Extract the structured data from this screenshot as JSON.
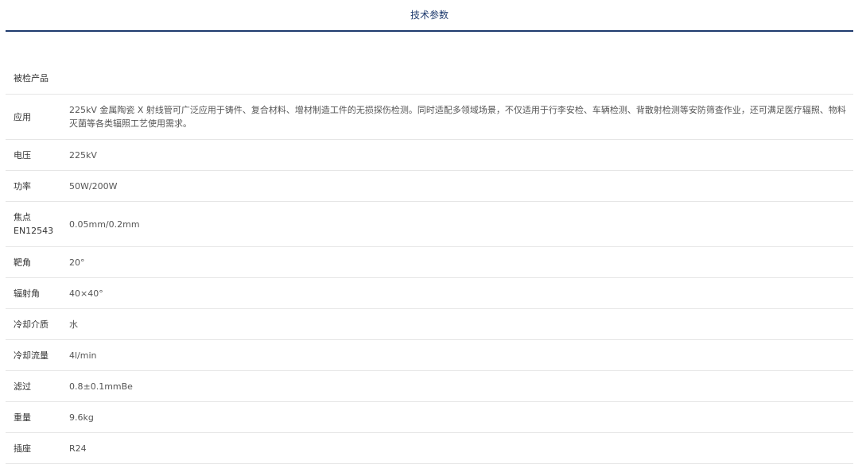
{
  "tabs": {
    "active_label": "技术参数"
  },
  "specs": {
    "product": {
      "label": "被检产品",
      "value": ""
    },
    "application": {
      "label": "应用",
      "value": "225kV 金属陶瓷 X 射线管可广泛应用于铸件、复合材料、增材制造工件的无损探伤检测。同时适配多领域场景，不仅适用于行李安检、车辆检测、背散射检测等安防筛查作业，还可满足医疗辐照、物料灭菌等各类辐照工艺使用需求。"
    },
    "voltage": {
      "label": "电压",
      "value": "225kV"
    },
    "power": {
      "label": "功率",
      "value": "50W/200W"
    },
    "focus": {
      "label_line1": "焦点",
      "label_line2": "EN12543",
      "value": "0.05mm/0.2mm"
    },
    "target_angle": {
      "label": "靶角",
      "value": "20°"
    },
    "radiation_angle": {
      "label": "辐射角",
      "value": "40×40°"
    },
    "cooling_medium": {
      "label": "冷却介质",
      "value": "水"
    },
    "cooling_flow": {
      "label": "冷却流量",
      "value": "4l/min"
    },
    "filter": {
      "label": "滤过",
      "value": "0.8±0.1mmBe"
    },
    "weight": {
      "label": "重量",
      "value": "9.6kg"
    },
    "socket": {
      "label": "插座",
      "value": "R24"
    }
  }
}
